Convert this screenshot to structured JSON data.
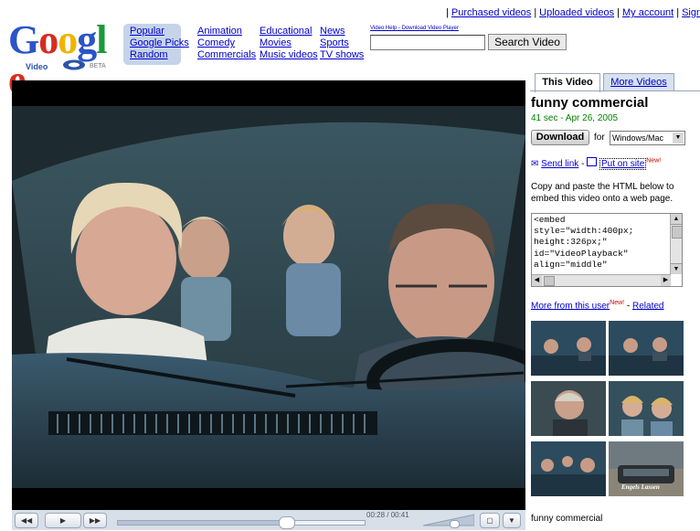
{
  "header": {
    "top_links": [
      "Purchased videos",
      "Uploaded videos",
      "My account",
      "Sign out"
    ],
    "logo": {
      "text": "Google",
      "sub": "Video",
      "beta": "BETA"
    },
    "categories": {
      "col1": [
        "Popular",
        "Google Picks",
        "Random"
      ],
      "col2": [
        "Animation",
        "Comedy",
        "Commercials"
      ],
      "col3": [
        "Educational",
        "Movies",
        "Music videos"
      ],
      "col4": [
        "News",
        "Sports",
        "TV shows"
      ]
    },
    "help_links": [
      "Video Help",
      "Download Video Player"
    ],
    "help_sep": " - ",
    "search": {
      "value": "",
      "button": "Search Video"
    }
  },
  "player": {
    "time": "00:28 / 00:41",
    "buttons": [
      "rewind-icon",
      "play-icon",
      "fast-forward-icon",
      "fullscreen-icon",
      "menu-icon"
    ],
    "progress": 0.68,
    "volume": 0.6
  },
  "sidebar": {
    "tabs": [
      "This Video",
      "More Videos"
    ],
    "title": "funny commercial",
    "meta": "41 sec - Apr 26, 2005",
    "download_button": "Download",
    "download_for": "for",
    "platform": "Windows/Mac",
    "send_link": "Send link",
    "put_on_site": "Put on site",
    "new_badge": "New!",
    "copy_text_1": "Copy and paste the HTML below to",
    "copy_text_2": "embed this video onto a web page.",
    "embed_code": "<embed\nstyle=\"width:400px;\nheight:326px;\"\nid=\"VideoPlayback\"\nalign=\"middle\"",
    "more_from_user": "More from this user",
    "related": "Related",
    "thumbnail_caption": "funny commercial",
    "thumb_overlay": "Engels Lassen"
  },
  "colors": {
    "link": "#0000cc",
    "meta_green": "#008000",
    "new_red": "#cc0000",
    "control_bg": "#d7dfe9"
  }
}
